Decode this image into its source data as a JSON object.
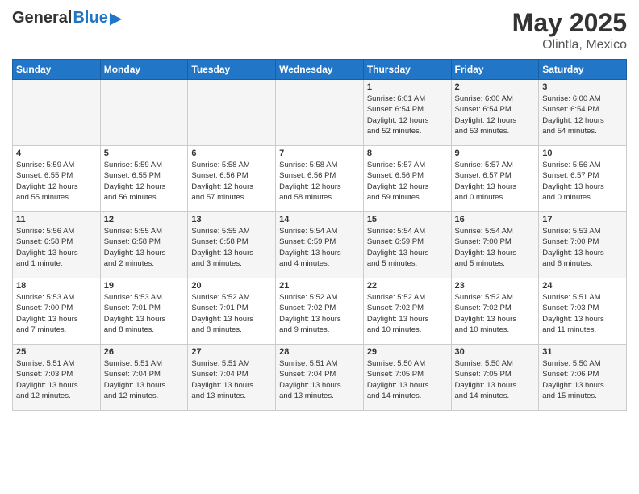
{
  "logo": {
    "text_general": "General",
    "text_blue": "Blue"
  },
  "title": "May 2025",
  "subtitle": "Olintla, Mexico",
  "headers": [
    "Sunday",
    "Monday",
    "Tuesday",
    "Wednesday",
    "Thursday",
    "Friday",
    "Saturday"
  ],
  "weeks": [
    [
      {
        "day": "",
        "info": ""
      },
      {
        "day": "",
        "info": ""
      },
      {
        "day": "",
        "info": ""
      },
      {
        "day": "",
        "info": ""
      },
      {
        "day": "1",
        "info": "Sunrise: 6:01 AM\nSunset: 6:54 PM\nDaylight: 12 hours\nand 52 minutes."
      },
      {
        "day": "2",
        "info": "Sunrise: 6:00 AM\nSunset: 6:54 PM\nDaylight: 12 hours\nand 53 minutes."
      },
      {
        "day": "3",
        "info": "Sunrise: 6:00 AM\nSunset: 6:54 PM\nDaylight: 12 hours\nand 54 minutes."
      }
    ],
    [
      {
        "day": "4",
        "info": "Sunrise: 5:59 AM\nSunset: 6:55 PM\nDaylight: 12 hours\nand 55 minutes."
      },
      {
        "day": "5",
        "info": "Sunrise: 5:59 AM\nSunset: 6:55 PM\nDaylight: 12 hours\nand 56 minutes."
      },
      {
        "day": "6",
        "info": "Sunrise: 5:58 AM\nSunset: 6:56 PM\nDaylight: 12 hours\nand 57 minutes."
      },
      {
        "day": "7",
        "info": "Sunrise: 5:58 AM\nSunset: 6:56 PM\nDaylight: 12 hours\nand 58 minutes."
      },
      {
        "day": "8",
        "info": "Sunrise: 5:57 AM\nSunset: 6:56 PM\nDaylight: 12 hours\nand 59 minutes."
      },
      {
        "day": "9",
        "info": "Sunrise: 5:57 AM\nSunset: 6:57 PM\nDaylight: 13 hours\nand 0 minutes."
      },
      {
        "day": "10",
        "info": "Sunrise: 5:56 AM\nSunset: 6:57 PM\nDaylight: 13 hours\nand 0 minutes."
      }
    ],
    [
      {
        "day": "11",
        "info": "Sunrise: 5:56 AM\nSunset: 6:58 PM\nDaylight: 13 hours\nand 1 minute."
      },
      {
        "day": "12",
        "info": "Sunrise: 5:55 AM\nSunset: 6:58 PM\nDaylight: 13 hours\nand 2 minutes."
      },
      {
        "day": "13",
        "info": "Sunrise: 5:55 AM\nSunset: 6:58 PM\nDaylight: 13 hours\nand 3 minutes."
      },
      {
        "day": "14",
        "info": "Sunrise: 5:54 AM\nSunset: 6:59 PM\nDaylight: 13 hours\nand 4 minutes."
      },
      {
        "day": "15",
        "info": "Sunrise: 5:54 AM\nSunset: 6:59 PM\nDaylight: 13 hours\nand 5 minutes."
      },
      {
        "day": "16",
        "info": "Sunrise: 5:54 AM\nSunset: 7:00 PM\nDaylight: 13 hours\nand 5 minutes."
      },
      {
        "day": "17",
        "info": "Sunrise: 5:53 AM\nSunset: 7:00 PM\nDaylight: 13 hours\nand 6 minutes."
      }
    ],
    [
      {
        "day": "18",
        "info": "Sunrise: 5:53 AM\nSunset: 7:00 PM\nDaylight: 13 hours\nand 7 minutes."
      },
      {
        "day": "19",
        "info": "Sunrise: 5:53 AM\nSunset: 7:01 PM\nDaylight: 13 hours\nand 8 minutes."
      },
      {
        "day": "20",
        "info": "Sunrise: 5:52 AM\nSunset: 7:01 PM\nDaylight: 13 hours\nand 8 minutes."
      },
      {
        "day": "21",
        "info": "Sunrise: 5:52 AM\nSunset: 7:02 PM\nDaylight: 13 hours\nand 9 minutes."
      },
      {
        "day": "22",
        "info": "Sunrise: 5:52 AM\nSunset: 7:02 PM\nDaylight: 13 hours\nand 10 minutes."
      },
      {
        "day": "23",
        "info": "Sunrise: 5:52 AM\nSunset: 7:02 PM\nDaylight: 13 hours\nand 10 minutes."
      },
      {
        "day": "24",
        "info": "Sunrise: 5:51 AM\nSunset: 7:03 PM\nDaylight: 13 hours\nand 11 minutes."
      }
    ],
    [
      {
        "day": "25",
        "info": "Sunrise: 5:51 AM\nSunset: 7:03 PM\nDaylight: 13 hours\nand 12 minutes."
      },
      {
        "day": "26",
        "info": "Sunrise: 5:51 AM\nSunset: 7:04 PM\nDaylight: 13 hours\nand 12 minutes."
      },
      {
        "day": "27",
        "info": "Sunrise: 5:51 AM\nSunset: 7:04 PM\nDaylight: 13 hours\nand 13 minutes."
      },
      {
        "day": "28",
        "info": "Sunrise: 5:51 AM\nSunset: 7:04 PM\nDaylight: 13 hours\nand 13 minutes."
      },
      {
        "day": "29",
        "info": "Sunrise: 5:50 AM\nSunset: 7:05 PM\nDaylight: 13 hours\nand 14 minutes."
      },
      {
        "day": "30",
        "info": "Sunrise: 5:50 AM\nSunset: 7:05 PM\nDaylight: 13 hours\nand 14 minutes."
      },
      {
        "day": "31",
        "info": "Sunrise: 5:50 AM\nSunset: 7:06 PM\nDaylight: 13 hours\nand 15 minutes."
      }
    ]
  ]
}
